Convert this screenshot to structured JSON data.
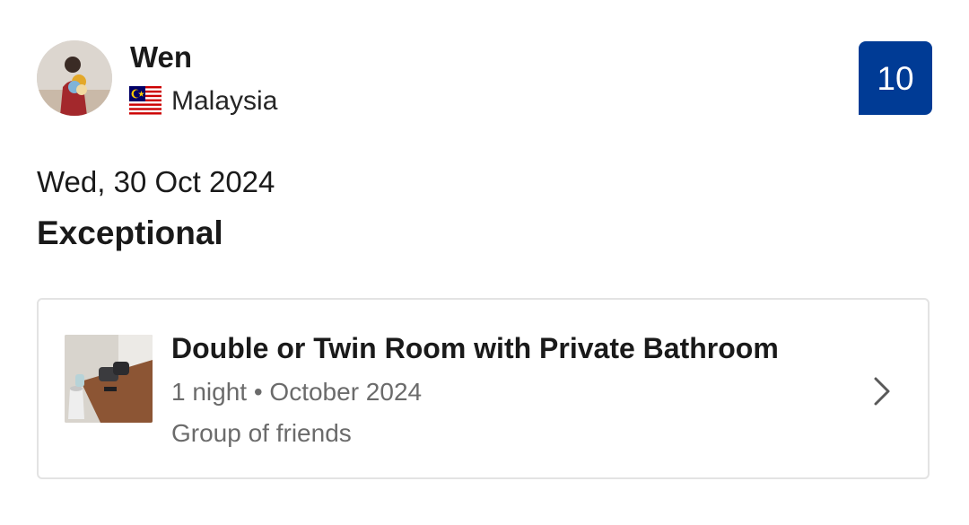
{
  "reviewer": {
    "name": "Wen",
    "country": "Malaysia",
    "flag_icon": "malaysia-flag-icon",
    "avatar_icon": "user-avatar"
  },
  "review": {
    "score": "10",
    "date": "Wed, 30 Oct 2024",
    "headline": "Exceptional"
  },
  "room": {
    "title": "Double or Twin Room with Private Bathroom",
    "stay_details": "1 night • October 2024",
    "traveller_type": "Group of friends",
    "thumbnail_icon": "room-photo",
    "chevron_icon": "chevron-right-icon"
  },
  "colors": {
    "score_badge_bg": "#003b95",
    "score_badge_text": "#ffffff",
    "primary_text": "#1a1a1a",
    "secondary_text": "#6b6b6b",
    "card_border": "#e3e3e3"
  }
}
